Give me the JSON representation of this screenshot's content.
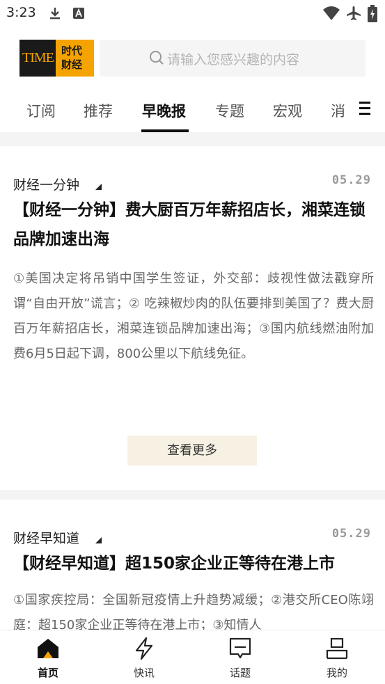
{
  "status_bar": {
    "time": "3:23",
    "icons": [
      "download-icon",
      "text-a-icon",
      "wifi-icon",
      "airplane-mode-icon",
      "battery-charging-icon"
    ]
  },
  "header": {
    "logo": {
      "mark": "TIME",
      "name": "时代财经"
    },
    "search": {
      "placeholder": "请输入您感兴趣的内容"
    },
    "tabs": [
      {
        "label": "订阅",
        "active": false
      },
      {
        "label": "推荐",
        "active": false
      },
      {
        "label": "早晚报",
        "active": true
      },
      {
        "label": "专题",
        "active": false
      },
      {
        "label": "宏观",
        "active": false
      },
      {
        "label": "消",
        "active": false
      }
    ]
  },
  "cards": [
    {
      "column": "财经一分钟",
      "date": "05.29",
      "headline": "【财经一分钟】费大厨百万年薪招店长，湘菜连锁品牌加速出海",
      "summary": "①美国决定将吊销中国学生签证，外交部：歧视性做法戳穿所谓“自由开放”谎言；② 吃辣椒炒肉的队伍要排到美国了？费大厨百万年薪招店长，湘菜连锁品牌加速出海；③国内航线燃油附加费6月5日起下调，800公里以下航线免征。",
      "more_label": "查看更多"
    },
    {
      "column": "财经早知道",
      "date": "05.29",
      "headline": "【财经早知道】超150家企业正等待在港上市",
      "summary": "①国家疾控局：全国新冠疫情上升趋势减缓；②港交所CEO陈翊庭：超150家企业正等待在港上市；③知情人"
    }
  ],
  "bottom_nav": [
    {
      "label": "首页",
      "icon": "home-icon",
      "active": true
    },
    {
      "label": "快讯",
      "icon": "lightning-icon",
      "active": false
    },
    {
      "label": "话题",
      "icon": "topic-icon",
      "active": false
    },
    {
      "label": "我的",
      "icon": "profile-icon",
      "active": false
    }
  ],
  "colors": {
    "brand": "#f5a300",
    "logo_dark": "#1a1a1a",
    "more_button_bg": "#f7f1e3"
  }
}
